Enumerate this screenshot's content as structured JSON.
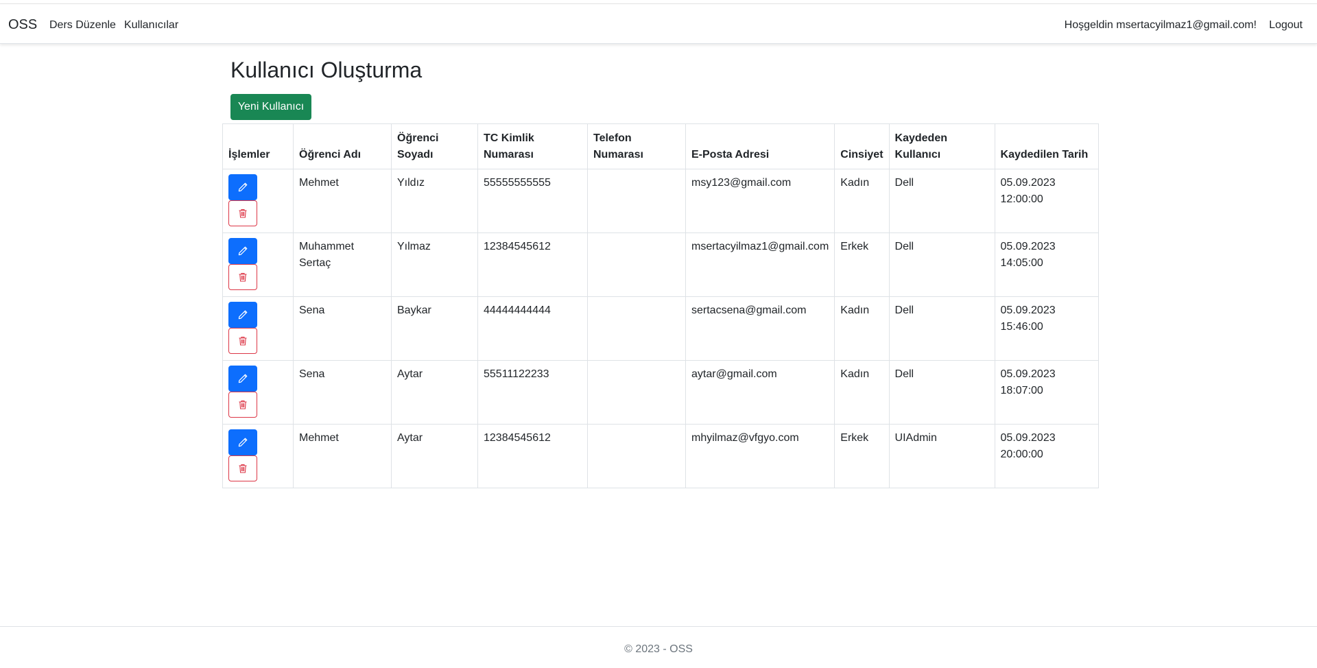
{
  "navbar": {
    "brand": "OSS",
    "links": [
      "Ders Düzenle",
      "Kullanıcılar"
    ],
    "greeting": "Hoşgeldin msertacyilmaz1@gmail.com!",
    "logout": "Logout"
  },
  "main": {
    "title": "Kullanıcı Oluşturma",
    "new_button": "Yeni Kullanıcı",
    "table": {
      "headers": [
        "İşlemler",
        "Öğrenci Adı",
        "Öğrenci Soyadı",
        "TC Kimlik Numarası",
        "Telefon Numarası",
        "E-Posta Adresi",
        "Cinsiyet",
        "Kaydeden Kullanıcı",
        "Kaydedilen Tarih"
      ],
      "rows": [
        {
          "first": "Mehmet",
          "last": "Yıldız",
          "tc": "55555555555",
          "phone": "",
          "email": "msy123@gmail.com",
          "gender": "Kadın",
          "by": "Dell",
          "date": "05.09.2023 12:00:00"
        },
        {
          "first": "Muhammet Sertaç",
          "last": "Yılmaz",
          "tc": "12384545612",
          "phone": "",
          "email": "msertacyilmaz1@gmail.com",
          "gender": "Erkek",
          "by": "Dell",
          "date": "05.09.2023 14:05:00"
        },
        {
          "first": "Sena",
          "last": "Baykar",
          "tc": "44444444444",
          "phone": "",
          "email": "sertacsena@gmail.com",
          "gender": "Kadın",
          "by": "Dell",
          "date": "05.09.2023 15:46:00"
        },
        {
          "first": "Sena",
          "last": "Aytar",
          "tc": "55511122233",
          "phone": "",
          "email": "aytar@gmail.com",
          "gender": "Kadın",
          "by": "Dell",
          "date": "05.09.2023 18:07:00"
        },
        {
          "first": "Mehmet",
          "last": "Aytar",
          "tc": "12384545612",
          "phone": "",
          "email": "mhyilmaz@vfgyo.com",
          "gender": "Erkek",
          "by": "UIAdmin",
          "date": "05.09.2023 20:00:00"
        }
      ]
    },
    "icons": {
      "edit": "pencil-icon",
      "delete": "trash-icon"
    },
    "colors": {
      "primary": "#0d6efd",
      "success": "#198754",
      "danger": "#dc3545"
    }
  },
  "footer": {
    "text": "© 2023 - OSS"
  }
}
